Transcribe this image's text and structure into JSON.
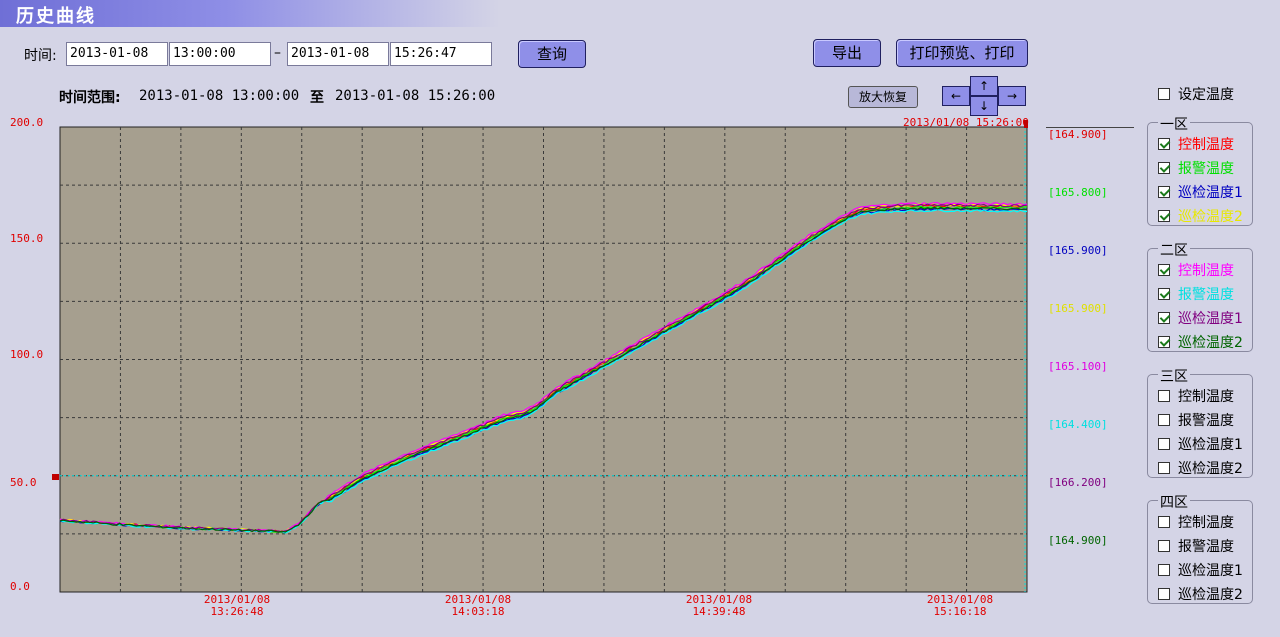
{
  "window": {
    "title": "历史曲线"
  },
  "query": {
    "time_label": "时间:",
    "start_date": "2013-01-08",
    "start_time": "13:00:00",
    "separator": "–",
    "end_date": "2013-01-08",
    "end_time": "15:26:47",
    "query_button": "查询",
    "export_button": "导出",
    "print_button": "打印预览、打印"
  },
  "range": {
    "label": "时间范围:",
    "from": "2013-01-08 13:00:00",
    "to_word": "至",
    "to": "2013-01-08 15:26:00"
  },
  "controls": {
    "zoom_reset": "放大恢复",
    "up": "↑",
    "down": "↓",
    "left": "←",
    "right": "→"
  },
  "chart": {
    "cursor_time": "2013/01/08 15:26:00",
    "left_extra_labels": [
      "50.0",
      "50.0"
    ],
    "colors": {
      "plot_bg": "#a69f8f",
      "grid": "#3a3a3a",
      "axis_text": "#e00000",
      "cursor": "#00e0e0"
    }
  },
  "chart_data": {
    "type": "line",
    "ylim": [
      0,
      200
    ],
    "y_ticks": [
      "200.0",
      "150.0",
      "100.0",
      "50.0",
      "0.0"
    ],
    "x_ticks": [
      {
        "date": "2013/01/08",
        "time": "13:26:48",
        "t": 26.8
      },
      {
        "date": "2013/01/08",
        "time": "14:03:18",
        "t": 63.3
      },
      {
        "date": "2013/01/08",
        "time": "14:39:48",
        "t": 99.8
      },
      {
        "date": "2013/01/08",
        "time": "15:16:18",
        "t": 136.3
      }
    ],
    "xlim_minutes": [
      0,
      146
    ],
    "reference_line": 50,
    "series": [
      {
        "color": "#ff0000",
        "offset": 0.0
      },
      {
        "color": "#00ff00",
        "offset": -0.6
      },
      {
        "color": "#0000cc",
        "offset": -1.4
      },
      {
        "color": "#ffff00",
        "offset": 0.5
      },
      {
        "color": "#ff00ff",
        "offset": 1.1
      },
      {
        "color": "#00ffff",
        "offset": -2.0
      },
      {
        "color": "#800080",
        "offset": 0.3
      },
      {
        "color": "#006400",
        "offset": -1.0
      }
    ],
    "base_curve": [
      [
        0,
        31
      ],
      [
        10,
        29
      ],
      [
        20,
        27.5
      ],
      [
        30,
        26.5
      ],
      [
        34,
        26
      ],
      [
        36,
        29
      ],
      [
        39,
        38
      ],
      [
        42,
        43
      ],
      [
        46,
        50
      ],
      [
        52,
        58
      ],
      [
        60,
        67
      ],
      [
        67,
        75
      ],
      [
        70,
        77
      ],
      [
        72,
        80
      ],
      [
        75,
        87
      ],
      [
        80,
        95
      ],
      [
        90,
        111
      ],
      [
        100,
        127
      ],
      [
        104,
        134
      ],
      [
        108,
        142
      ],
      [
        110,
        146
      ],
      [
        113,
        152
      ],
      [
        116,
        157
      ],
      [
        119,
        162
      ],
      [
        121,
        164.5
      ],
      [
        126,
        165.8
      ],
      [
        132,
        166.1
      ],
      [
        140,
        165.9
      ],
      [
        146,
        165.8
      ]
    ]
  },
  "right_values": [
    {
      "text": "[164.900]",
      "color": "#e00000"
    },
    {
      "text": "[165.800]",
      "color": "#00e000"
    },
    {
      "text": "[165.900]",
      "color": "#0000c0"
    },
    {
      "text": "[165.900]",
      "color": "#e0e000"
    },
    {
      "text": "[165.100]",
      "color": "#e000e0"
    },
    {
      "text": "[164.400]",
      "color": "#00e0e0"
    },
    {
      "text": "[166.200]",
      "color": "#800080"
    },
    {
      "text": "[164.900]",
      "color": "#006400"
    }
  ],
  "legend": {
    "set_temp": {
      "label": "设定温度",
      "checked": false
    },
    "groups": [
      {
        "title": "一区",
        "items": [
          {
            "label": "控制温度",
            "checked": true,
            "color": "#ff0000"
          },
          {
            "label": "报警温度",
            "checked": true,
            "color": "#00e000"
          },
          {
            "label": "巡检温度1",
            "checked": true,
            "color": "#0000c0"
          },
          {
            "label": "巡检温度2",
            "checked": true,
            "color": "#e8e800"
          }
        ]
      },
      {
        "title": "二区",
        "items": [
          {
            "label": "控制温度",
            "checked": true,
            "color": "#ff00ff"
          },
          {
            "label": "报警温度",
            "checked": true,
            "color": "#00e0e0"
          },
          {
            "label": "巡检温度1",
            "checked": true,
            "color": "#800080"
          },
          {
            "label": "巡检温度2",
            "checked": true,
            "color": "#006400"
          }
        ]
      },
      {
        "title": "三区",
        "items": [
          {
            "label": "控制温度",
            "checked": false,
            "color": "#000000"
          },
          {
            "label": "报警温度",
            "checked": false,
            "color": "#000000"
          },
          {
            "label": "巡检温度1",
            "checked": false,
            "color": "#000000"
          },
          {
            "label": "巡检温度2",
            "checked": false,
            "color": "#000000"
          }
        ]
      },
      {
        "title": "四区",
        "items": [
          {
            "label": "控制温度",
            "checked": false,
            "color": "#000000"
          },
          {
            "label": "报警温度",
            "checked": false,
            "color": "#000000"
          },
          {
            "label": "巡检温度1",
            "checked": false,
            "color": "#000000"
          },
          {
            "label": "巡检温度2",
            "checked": false,
            "color": "#000000"
          }
        ]
      }
    ]
  }
}
